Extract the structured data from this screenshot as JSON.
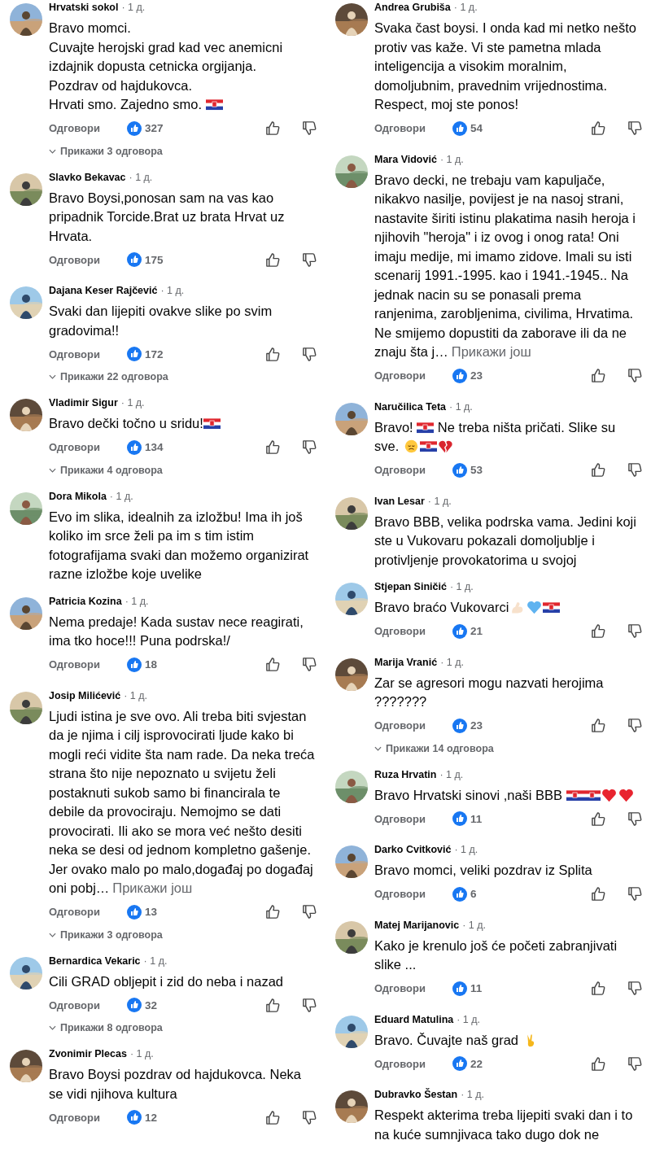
{
  "columns": [
    {
      "comments": [
        {
          "author": "Hrvatski sokol",
          "time": "· 1 д.",
          "body": [
            {
              "kind": "text",
              "text": "Bravo momci.\nCuvajte herojski grad kad vec anemicni izdajnik dopusta cetnicka orgijanja.\nPozdrav od hajdukovca.\nHrvati smo. Zajedno smo. "
            },
            {
              "kind": "flag"
            }
          ],
          "reply": "Одговори",
          "likes": "327",
          "replies_link": "Прикажи 3 одговора"
        },
        {
          "author": "Slavko Bekavac",
          "time": "· 1 д.",
          "body": [
            {
              "kind": "text",
              "text": "Bravo Boysi,ponosan sam na vas kao pripadnik Torcide.Brat uz brata Hrvat uz Hrvata."
            }
          ],
          "reply": "Одговори",
          "likes": "175"
        },
        {
          "author": "Dajana Keser Rajčević",
          "time": "· 1 д.",
          "body": [
            {
              "kind": "text",
              "text": "Svaki dan lijepiti ovakve slike po svim gradovima!!"
            }
          ],
          "reply": "Одговори",
          "likes": "172",
          "replies_link": "Прикажи 22 одговора"
        },
        {
          "author": "Vladimir Sigur",
          "time": "· 1 д.",
          "body": [
            {
              "kind": "text",
              "text": "Bravo dečki točno u sridu!"
            },
            {
              "kind": "flag"
            }
          ],
          "reply": "Одговори",
          "likes": "134",
          "replies_link": "Прикажи 4 одговора"
        },
        {
          "author": "Dora Mikola",
          "time": "· 1 д.",
          "body": [
            {
              "kind": "text",
              "text": "Evo im slika, idealnih za izložbu! Ima ih još koliko im srce želi pa im s tim istim fotografijama svaki dan možemo organizirat razne izložbe koje uvelike"
            }
          ]
        },
        {
          "author": "Patricia Kozina",
          "time": "· 1 д.",
          "body": [
            {
              "kind": "text",
              "text": "Nema predaje! Kada sustav nece reagirati,  ima tko hoce!!! Puna podrska!/"
            }
          ],
          "reply": "Одговори",
          "likes": "18"
        },
        {
          "author": "Josip Milićević",
          "time": "· 1 д.",
          "body": [
            {
              "kind": "text",
              "text": "Ljudi istina je sve ovo. Ali treba biti svjestan da je njima i cilj isprovocirati ljude kako bi mogli reći vidite šta nam rade. Da neka treća strana što nije nepoznato u svijetu želi postaknuti sukob samo bi financirala te debile da provociraju. Nemojmo se dati provocirati. Ili ako se mora već nešto desiti neka se desi od jednom kompletno gašenje. Jer ovako malo po malo,događaj po događaj oni pobj…"
            }
          ],
          "more_link": "Прикажи још",
          "reply": "Одговори",
          "likes": "13",
          "replies_link": "Прикажи 3 одговора"
        },
        {
          "author": "Bernardica Vekaric",
          "time": "· 1 д.",
          "body": [
            {
              "kind": "text",
              "text": "Cili GRAD obljepit i zid do neba i nazad"
            }
          ],
          "reply": "Одговори",
          "likes": "32",
          "replies_link": "Прикажи 8 одговора"
        },
        {
          "author": "Zvonimir Plecas",
          "time": "· 1 д.",
          "body": [
            {
              "kind": "text",
              "text": "Bravo Boysi pozdrav od hajdukovca. Neka se vidi njihova kultura"
            }
          ],
          "reply": "Одговори",
          "likes": "12"
        }
      ]
    },
    {
      "comments": [
        {
          "author": "Andrea Grubiša",
          "time": "· 1 д.",
          "body": [
            {
              "kind": "text",
              "text": "Svaka čast boysi. I onda kad mi netko nešto protiv vas kaže. Vi ste pametna mlada inteligencija a visokim moralnim, domoljubnim, pravednim vrijednostima. Respect, moj ste ponos!"
            }
          ],
          "reply": "Одговори",
          "likes": "54"
        },
        {
          "author": "Mara Vidović",
          "time": "· 1 д.",
          "body": [
            {
              "kind": "text",
              "text": "Bravo decki, ne trebaju vam kapuljače, nikakvo nasilje, povijest je na nasoj strani, nastavite širiti istinu plakatima nasih heroja i njihovih \"heroja\" i iz ovog i onog rata! Oni imaju medije, mi imamo zidove. Imali su isti scenarij 1991.-1995. kao i 1941.-1945.. Na jednak nacin su se ponasali prema ranjenima, zarobljenima, civilima, Hrvatima. Ne smijemo dopustiti da zaborave ili da ne znaju šta j…"
            }
          ],
          "more_link": "Прикажи још",
          "reply": "Одговори",
          "likes": "23"
        },
        {
          "author": "Naručilica Teta",
          "time": "· 1 д.",
          "body": [
            {
              "kind": "text",
              "text": "Bravo! "
            },
            {
              "kind": "flag"
            },
            {
              "kind": "text",
              "text": " Ne treba ništa pričati. Slike su sve. "
            },
            {
              "kind": "sad"
            },
            {
              "kind": "flag"
            },
            {
              "kind": "broken-heart"
            }
          ],
          "reply": "Одговори",
          "likes": "53"
        },
        {
          "author": "Ivan Lesar",
          "time": "· 1 д.",
          "body": [
            {
              "kind": "text",
              "text": "Bravo BBB, velika podrska vama. Jedini koji ste u Vukovaru pokazali domoljublje i protivljenje provokatorima u svojoj"
            }
          ]
        },
        {
          "author": "Stjepan Siničić",
          "time": "· 1 д.",
          "body": [
            {
              "kind": "text",
              "text": "Bravo braćo Vukovarci"
            },
            {
              "kind": "muscle"
            },
            {
              "kind": "blue-heart"
            },
            {
              "kind": "flag"
            }
          ],
          "reply": "Одговори",
          "likes": "21"
        },
        {
          "author": "Marija Vranić",
          "time": "· 1 д.",
          "body": [
            {
              "kind": "text",
              "text": "Zar se agresori mogu nazvati herojima ???????"
            }
          ],
          "reply": "Одговори",
          "likes": "23",
          "replies_link": "Прикажи 14 одговора"
        },
        {
          "author": "Ruza Hrvatin",
          "time": "· 1 д.",
          "body": [
            {
              "kind": "text",
              "text": "Bravo Hrvatski sinovi ,naši BBB "
            },
            {
              "kind": "flag"
            },
            {
              "kind": "flag"
            },
            {
              "kind": "heart"
            },
            {
              "kind": "heart"
            }
          ],
          "reply": "Одговори",
          "likes": "11"
        },
        {
          "author": "Darko Cvitković",
          "time": "· 1 д.",
          "body": [
            {
              "kind": "text",
              "text": "Bravo momci, veliki pozdrav iz Splita"
            }
          ],
          "reply": "Одговори",
          "likes": "6"
        },
        {
          "author": "Matej Marijanovic",
          "time": "· 1 д.",
          "body": [
            {
              "kind": "text",
              "text": "Kako je krenulo još će početi zabranjivati slike  ..."
            }
          ],
          "reply": "Одговори",
          "likes": "11"
        },
        {
          "author": "Eduard Matulina",
          "time": "· 1 д.",
          "body": [
            {
              "kind": "text",
              "text": "Bravo. Čuvajte naš grad "
            },
            {
              "kind": "victory"
            }
          ],
          "reply": "Одговори",
          "likes": "22"
        },
        {
          "author": "Dubravko Šestan",
          "time": "· 1 д.",
          "body": [
            {
              "kind": "text",
              "text": "Respekt akterima treba lijepiti svaki dan i to na kuće sumnjivaca tako dugo dok ne"
            }
          ]
        }
      ]
    }
  ]
}
